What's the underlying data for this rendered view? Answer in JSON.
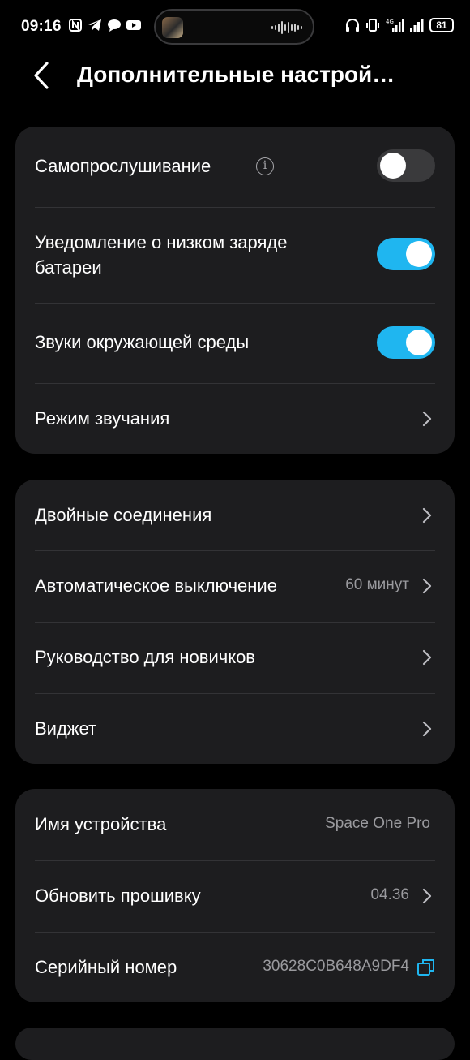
{
  "status_bar": {
    "time": "09:16",
    "battery": "81",
    "network": "4G"
  },
  "header": {
    "title": "Дополнительные настрой…"
  },
  "section1": {
    "items": [
      {
        "label": "Самопрослушивание",
        "toggle": false
      },
      {
        "label": "Уведомление о низком заряде батареи",
        "toggle": true
      },
      {
        "label": "Звуки окружающей среды",
        "toggle": true
      },
      {
        "label": "Режим звучания"
      }
    ]
  },
  "section2": {
    "items": [
      {
        "label": "Двойные соединения"
      },
      {
        "label": "Автоматическое выключение",
        "value": "60 минут"
      },
      {
        "label": "Руководство для новичков"
      },
      {
        "label": "Виджет"
      }
    ]
  },
  "section3": {
    "items": [
      {
        "label": "Имя устройства",
        "value": "Space One Pro"
      },
      {
        "label": "Обновить прошивку",
        "value": "04.36"
      },
      {
        "label": "Серийный номер",
        "value": "30628C0B648A9DF4"
      }
    ]
  },
  "colors": {
    "accent": "#1fb6f0",
    "card": "#1d1d1f",
    "background": "#000000"
  }
}
